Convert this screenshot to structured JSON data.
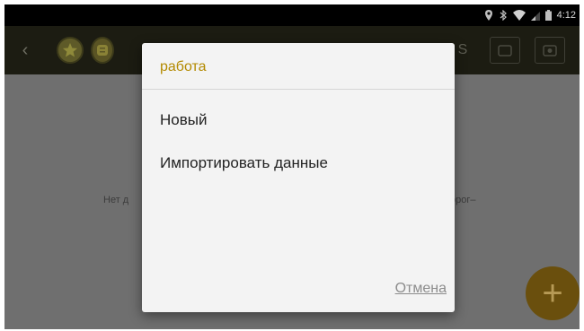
{
  "status_bar": {
    "time": "4:12",
    "icons": [
      "location-icon",
      "bluetooth-icon",
      "wifi-icon",
      "signal-icon",
      "battery-icon"
    ]
  },
  "app_bar": {
    "icons": [
      "back-arrow-icon",
      "star-icon",
      "coin-icon",
      "s-icon",
      "box-icon",
      "box-icon"
    ],
    "s_label": "S"
  },
  "main": {
    "empty_text_left": "Нет д",
    "empty_text_right": "орог–"
  },
  "dialog": {
    "title": "работа",
    "items": [
      "Новый",
      "Импортировать данные"
    ],
    "cancel_label": "Отмена"
  },
  "colors": {
    "accent": "#b38a00",
    "fab": "#6a4f0d",
    "dim_overlay": "#6f6f6f"
  }
}
